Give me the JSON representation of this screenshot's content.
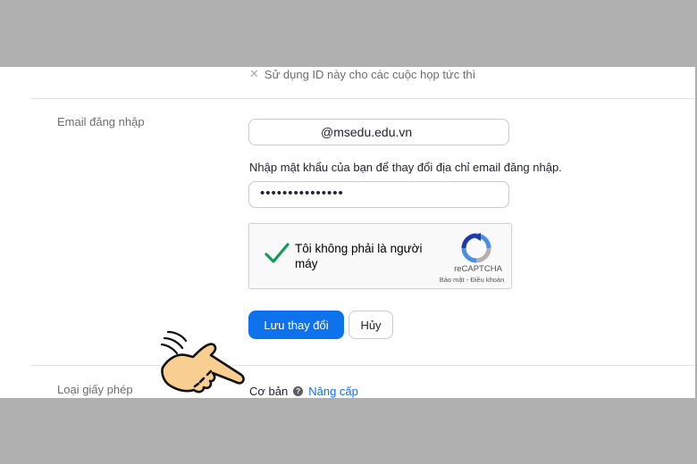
{
  "pmi": {
    "option_label": "Sử dụng ID này cho các cuộc họp tức thì",
    "icon": "close-x-icon"
  },
  "login_email": {
    "label": "Email đăng nhập",
    "email_value": "@msedu.edu.vn",
    "hint": "Nhập mật khẩu của bạn để thay đổi địa chỉ email đăng nhập.",
    "password_value": "•••••••••••••••"
  },
  "captcha": {
    "label": "Tôi không phải là người máy",
    "brand": "reCAPTCHA",
    "terms": "Bảo mật - Điều khoản",
    "checked": true,
    "icons": [
      "checkmark-icon",
      "recaptcha-logo-icon"
    ]
  },
  "actions": {
    "save_label": "Lưu thay đổi",
    "cancel_label": "Hủy"
  },
  "license": {
    "label": "Loại giấy phép",
    "value": "Cơ bản",
    "help_icon": "?",
    "upgrade_label": "Nâng cấp"
  },
  "overlay": {
    "pointer_icon": "pointing-hand-icon"
  },
  "colors": {
    "accent": "#0e72ed",
    "check": "#0f9d58",
    "frame": "#b0b0b0"
  }
}
